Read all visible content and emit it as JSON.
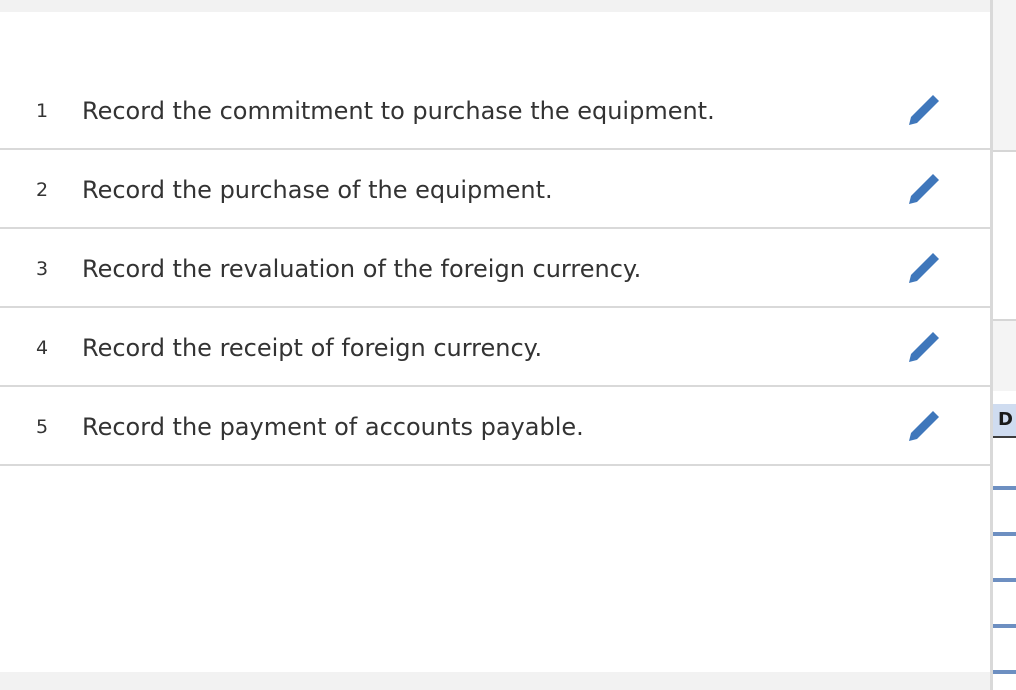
{
  "tasks": [
    {
      "num": "1",
      "label": "Record the commitment to purchase the equipment."
    },
    {
      "num": "2",
      "label": "Record the purchase of the equipment."
    },
    {
      "num": "3",
      "label": "Record the revaluation of the foreign currency."
    },
    {
      "num": "4",
      "label": "Record the receipt of foreign currency."
    },
    {
      "num": "5",
      "label": "Record the payment of accounts payable."
    }
  ],
  "right_panel": {
    "header_label": "D"
  },
  "colors": {
    "pencil": "#3f77bb",
    "header_bg": "#cfdcf0",
    "divider": "#d9d9d9"
  },
  "icons": {
    "edit": "pencil-icon"
  }
}
